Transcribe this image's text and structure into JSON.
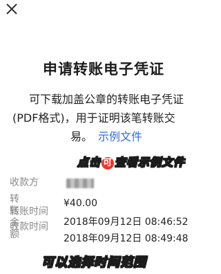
{
  "close_icon": "close-icon",
  "title": "申请转账电子凭证",
  "description": {
    "line1": "可下载加盖公章的转账电子凭证",
    "line2": "(PDF格式)，用于证明该笔转账交",
    "line3": "易。",
    "example_link": "示例文件"
  },
  "annotations": {
    "tap_pre": "点击",
    "tap_badge": "可",
    "tap_post": "查看示例文件",
    "select_range": "可以选择时间范围"
  },
  "fields": {
    "payee_label": "收款方",
    "amount_label": "转账金额",
    "time1_label": "转账时间",
    "time2_label": "收款时间",
    "amount_value": "¥40.00",
    "time1_value": "2018年09月12日  08:46:52",
    "time2_value": "2018年09月12日  08:49:48"
  },
  "colors": {
    "link": "#2f6bd8",
    "annotation_fill": "#f7e64a",
    "annotation_stroke": "#1c1c1c",
    "badge": "#e23b2e",
    "label": "#8a8a8a"
  }
}
